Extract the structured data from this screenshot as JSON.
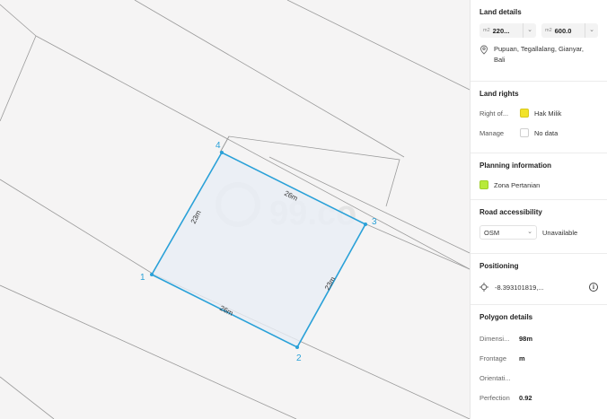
{
  "map": {
    "vertex_labels": [
      "1",
      "2",
      "3",
      "4"
    ],
    "edge_labels": [
      "23m",
      "26m",
      "23m",
      "26m"
    ],
    "watermark": "99.co",
    "polygon_fill": "#e9eef5",
    "polygon_stroke": "#2aa1d8"
  },
  "panel": {
    "land_details": {
      "title": "Land details",
      "building_unit": "m2",
      "building_value": "220...",
      "land_unit": "m2",
      "land_value": "600.0",
      "location": "Pupuan, Tegallalang, Gianyar, Bali"
    },
    "land_rights": {
      "title": "Land rights",
      "rows": [
        {
          "label": "Right of...",
          "value": "Hak Milik",
          "color": "#f2e32a"
        },
        {
          "label": "Manage",
          "value": "No data",
          "color": "#ffffff"
        }
      ]
    },
    "planning": {
      "title": "Planning information",
      "zone": "Zona Pertanian",
      "zone_color": "#b8ea3a"
    },
    "road": {
      "title": "Road accessibility",
      "source": "OSM",
      "status": "Unavailable"
    },
    "positioning": {
      "title": "Positioning",
      "coords": "-8.393101819,..."
    },
    "polygon_details": {
      "title": "Polygon details",
      "rows": [
        {
          "label": "Dimensi...",
          "value": "98m"
        },
        {
          "label": "Frontage",
          "value": "m"
        },
        {
          "label": "Orientati...",
          "value": ""
        },
        {
          "label": "Perfection",
          "value": "0.92"
        }
      ]
    }
  }
}
